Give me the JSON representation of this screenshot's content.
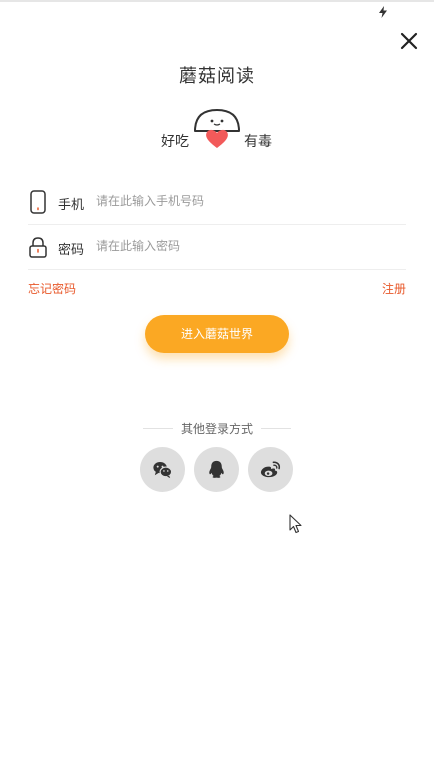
{
  "app": {
    "title": "蘑菇阅读"
  },
  "mascot": {
    "left_text": "好吃",
    "right_text": "有毒"
  },
  "form": {
    "phone": {
      "label": "手机",
      "placeholder": "请在此输入手机号码",
      "value": ""
    },
    "password": {
      "label": "密码",
      "placeholder": "请在此输入密码",
      "value": ""
    }
  },
  "links": {
    "forgot": "忘记密码",
    "register": "注册"
  },
  "login_button": {
    "label": "进入蘑菇世界"
  },
  "other_login": {
    "title": "其他登录方式",
    "options": [
      "wechat-icon",
      "qq-icon",
      "weibo-icon"
    ]
  },
  "colors": {
    "accent": "#fba823",
    "link": "#e8582a",
    "heart": "#f25a5a",
    "social_bg": "#dedede"
  }
}
